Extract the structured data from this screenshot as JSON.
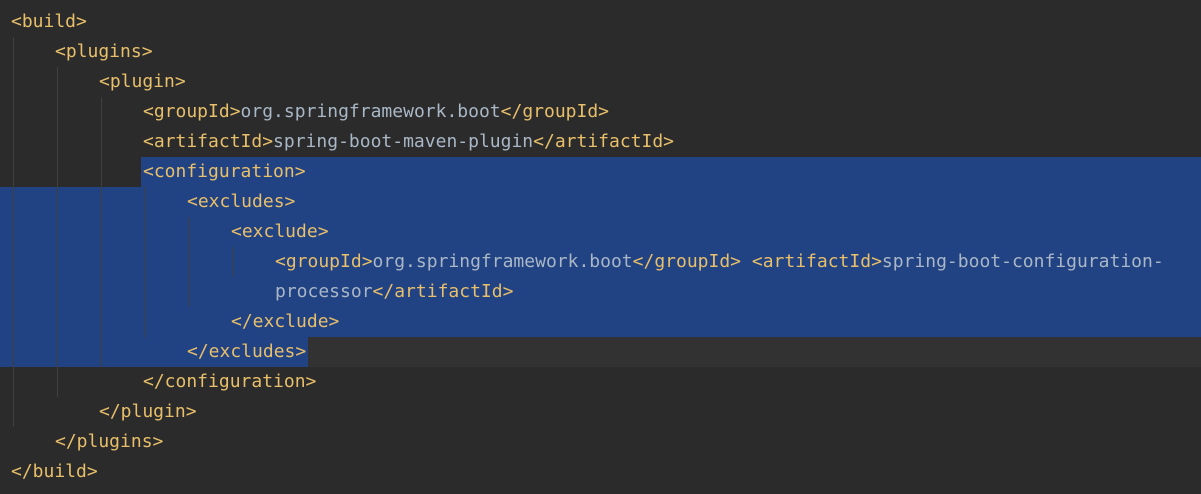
{
  "editor": {
    "language": "xml",
    "theme": {
      "background": "#2b2b2b",
      "selection": "#214283",
      "tag_color": "#e8bf6a",
      "text_color": "#a9b7c6",
      "caret_line": "#323232"
    },
    "selected_lines": [
      6,
      13
    ],
    "lines": [
      {
        "indent": 0,
        "parts": [
          {
            "t": "tag",
            "s": "<build>"
          }
        ]
      },
      {
        "indent": 1,
        "parts": [
          {
            "t": "tag",
            "s": "<plugins>"
          }
        ]
      },
      {
        "indent": 2,
        "parts": [
          {
            "t": "tag",
            "s": "<plugin>"
          }
        ]
      },
      {
        "indent": 3,
        "parts": [
          {
            "t": "tag",
            "s": "<groupId>"
          },
          {
            "t": "txt",
            "s": "org.springframework.boot"
          },
          {
            "t": "tag",
            "s": "</groupId>"
          }
        ]
      },
      {
        "indent": 3,
        "parts": [
          {
            "t": "tag",
            "s": "<artifactId>"
          },
          {
            "t": "txt",
            "s": "spring-boot-maven-plugin"
          },
          {
            "t": "tag",
            "s": "</artifactId>"
          }
        ]
      },
      {
        "indent": 3,
        "parts": [
          {
            "t": "tag",
            "s": "<configuration>"
          }
        ]
      },
      {
        "indent": 4,
        "parts": [
          {
            "t": "tag",
            "s": "<excludes>"
          }
        ]
      },
      {
        "indent": 5,
        "parts": [
          {
            "t": "tag",
            "s": "<exclude>"
          }
        ]
      },
      {
        "indent": 6,
        "parts": [
          {
            "t": "tag",
            "s": "<groupId>"
          },
          {
            "t": "txt",
            "s": "org.springframework.boot"
          },
          {
            "t": "tag",
            "s": "</groupId>"
          },
          {
            "t": "txt",
            "s": " "
          },
          {
            "t": "tag",
            "s": "<artifactId>"
          },
          {
            "t": "txt",
            "s": "spring-boot-configuration-"
          }
        ]
      },
      {
        "indent": 6,
        "parts": [
          {
            "t": "txt",
            "s": "processor"
          },
          {
            "t": "tag",
            "s": "</artifactId>"
          }
        ]
      },
      {
        "indent": 5,
        "parts": [
          {
            "t": "tag",
            "s": "</exclude>"
          }
        ]
      },
      {
        "indent": 4,
        "parts": [
          {
            "t": "tag",
            "s": "</excludes>"
          }
        ]
      },
      {
        "indent": 3,
        "parts": [
          {
            "t": "tag",
            "s": "</configuration>"
          }
        ]
      },
      {
        "indent": 2,
        "parts": [
          {
            "t": "tag",
            "s": "</plugin>"
          }
        ]
      },
      {
        "indent": 1,
        "parts": [
          {
            "t": "tag",
            "s": "</plugins>"
          }
        ]
      },
      {
        "indent": 0,
        "parts": [
          {
            "t": "tag",
            "s": "</build>"
          }
        ]
      }
    ]
  }
}
